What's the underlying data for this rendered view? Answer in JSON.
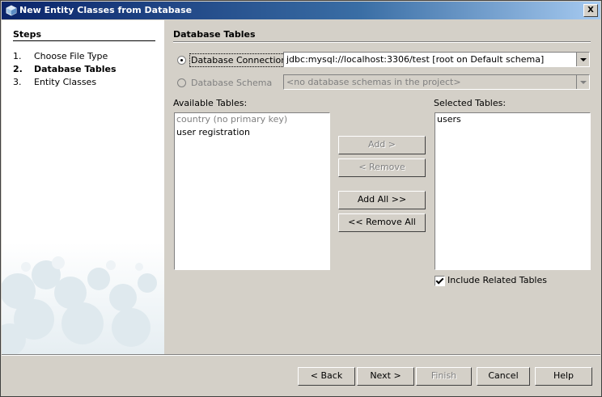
{
  "window": {
    "title": "New Entity Classes from Database",
    "close_label": "X"
  },
  "steps": {
    "title": "Steps",
    "items": [
      {
        "num": "1.",
        "label": "Choose File Type"
      },
      {
        "num": "2.",
        "label": "Database Tables"
      },
      {
        "num": "3.",
        "label": "Entity Classes"
      }
    ],
    "current": 1
  },
  "panel": {
    "title": "Database Tables",
    "db_connection_label": "Database Connection:",
    "db_connection_value": "jdbc:mysql://localhost:3306/test [root on Default schema]",
    "db_schema_label": "Database Schema",
    "db_schema_value": "<no database schemas in the project>",
    "available_label": "Available Tables:",
    "available_tables": [
      {
        "label": "country (no primary key)",
        "muted": true
      },
      {
        "label": "user registration",
        "muted": false
      }
    ],
    "selected_label": "Selected Tables:",
    "selected_tables": [
      "users"
    ],
    "include_related_label": "Include Related Tables",
    "include_related_checked": true
  },
  "buttons": {
    "add": "Add >",
    "remove": "< Remove",
    "add_all": "Add All >>",
    "remove_all": "<< Remove All"
  },
  "footer": {
    "back": "< Back",
    "next": "Next >",
    "finish": "Finish",
    "cancel": "Cancel",
    "help": "Help"
  }
}
